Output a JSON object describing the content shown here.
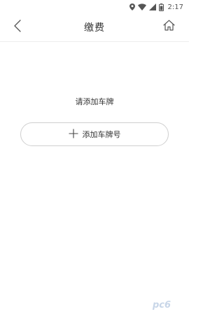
{
  "status_bar": {
    "time": "2:17",
    "icons": [
      "location-icon",
      "wifi-icon",
      "signal-icon",
      "battery-icon"
    ]
  },
  "header": {
    "title": "缴费",
    "back_icon": "chevron-left-icon",
    "home_icon": "home-icon"
  },
  "main": {
    "prompt": "请添加车牌",
    "add_button_label": "添加车牌号",
    "add_button_icon": "plus-icon"
  },
  "watermark": {
    "text": "pc6"
  },
  "colors": {
    "background": "#ffffff",
    "text": "#333333",
    "border": "#cfcfcf",
    "watermark": "#c8d6e8"
  }
}
